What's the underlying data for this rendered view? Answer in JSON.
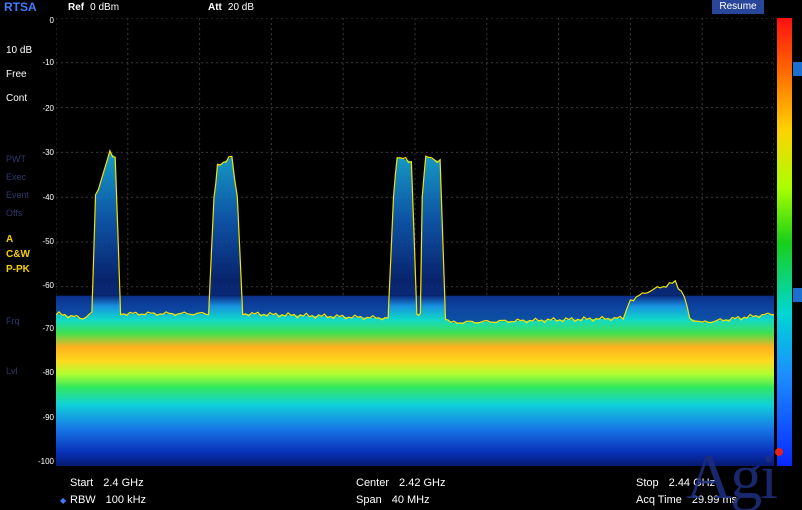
{
  "header": {
    "mode": "RTSA",
    "ref_label": "Ref",
    "ref_value": "0 dBm",
    "att_label": "Att",
    "att_value": "20 dB",
    "resume_label": "Resume"
  },
  "left_panel": {
    "scale": "10 dB",
    "trigger": "Free",
    "sweep": "Cont",
    "trace_mode": "A",
    "trace_type": "C&W",
    "detector": "P-PK",
    "dim_items": [
      "PWT",
      "Exec",
      "Event",
      "Offs",
      "Frq",
      "Lvl"
    ]
  },
  "y_axis": {
    "ticks": [
      "0",
      "-10",
      "-20",
      "-30",
      "-40",
      "-50",
      "-60",
      "-70",
      "-80",
      "-90",
      "-100"
    ]
  },
  "footer": {
    "start_label": "Start",
    "start_value": "2.4 GHz",
    "center_label": "Center",
    "center_value": "2.42 GHz",
    "stop_label": "Stop",
    "stop_value": "2.44 GHz",
    "rbw_label": "RBW",
    "rbw_value": "100 kHz",
    "span_label": "Span",
    "span_value": "40 MHz",
    "acq_label": "Acq Time",
    "acq_value": "29.99 ms"
  },
  "watermark_text": "Agi",
  "chart_data": {
    "type": "line",
    "title": "",
    "xlabel": "",
    "ylabel": "",
    "x_unit": "GHz",
    "y_unit": "dBm",
    "xlim": [
      2.4,
      2.44
    ],
    "ylim": [
      -100,
      0
    ],
    "grid": true,
    "series": [
      {
        "x": [
          2.4,
          2.4015,
          2.402,
          2.4022,
          2.403,
          2.4033,
          2.4036,
          2.4085,
          2.4088,
          2.409,
          2.4098,
          2.4101,
          2.4104,
          2.4185,
          2.4188,
          2.419,
          2.4198,
          2.4201,
          2.4203,
          2.4204,
          2.4206,
          2.4214,
          2.4217,
          2.422,
          2.4316,
          2.432,
          2.433,
          2.4345,
          2.435,
          2.4353,
          2.436,
          2.44
        ],
        "y": [
          -66,
          -67,
          -66,
          -40,
          -30,
          -31,
          -66,
          -66,
          -40,
          -33,
          -31,
          -40,
          -66,
          -67,
          -40,
          -31,
          -32,
          -66,
          -66,
          -40,
          -31,
          -32,
          -67,
          -68,
          -67,
          -63,
          -61,
          -59,
          -62,
          -67,
          -68,
          -66
        ]
      }
    ],
    "noise_floor_band": {
      "center_dbm": -75,
      "low_dbm": -100,
      "high_dbm": -62
    }
  },
  "colors": {
    "trace": "#f5e400",
    "grid": "#3a3a3a",
    "accent": "#3f7cff",
    "resume_bg": "#28479a"
  }
}
